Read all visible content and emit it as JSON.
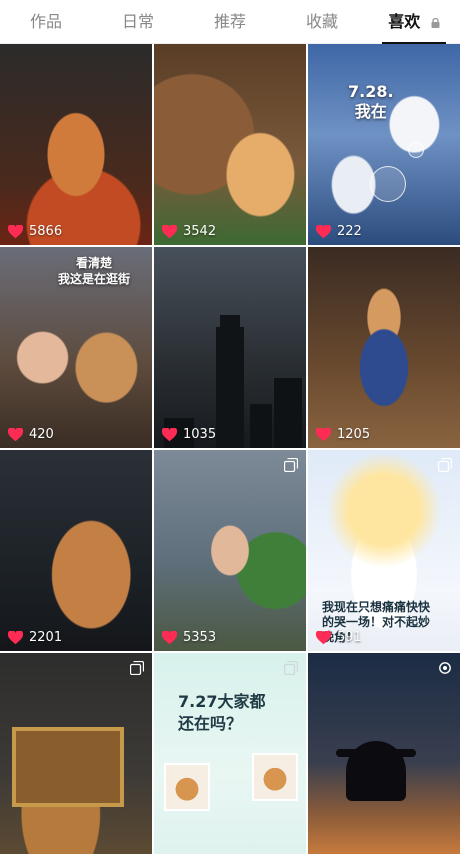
{
  "tabs": [
    {
      "label": "作品",
      "active": false
    },
    {
      "label": "日常",
      "active": false
    },
    {
      "label": "推荐",
      "active": false
    },
    {
      "label": "收藏",
      "active": false
    },
    {
      "label": "喜欢",
      "active": true,
      "locked": true
    }
  ],
  "accent": "#fe2c55",
  "grid": [
    {
      "likes": "5866",
      "caption": ""
    },
    {
      "likes": "3542",
      "caption": ""
    },
    {
      "likes": "222",
      "caption": "7.28.\n我在"
    },
    {
      "likes": "420",
      "caption": "看清楚\n我这是在逛街"
    },
    {
      "likes": "1035",
      "caption": ""
    },
    {
      "likes": "1205",
      "caption": ""
    },
    {
      "likes": "2201",
      "caption": ""
    },
    {
      "likes": "5353",
      "caption": ""
    },
    {
      "likes": "591",
      "caption": "我现在只想痛痛快快\n的哭一场！对不起妙\n晚角！"
    },
    {
      "likes": "",
      "caption": ""
    },
    {
      "likes": "",
      "caption": "7.27大家都\n还在吗？"
    },
    {
      "likes": "",
      "caption": ""
    }
  ]
}
